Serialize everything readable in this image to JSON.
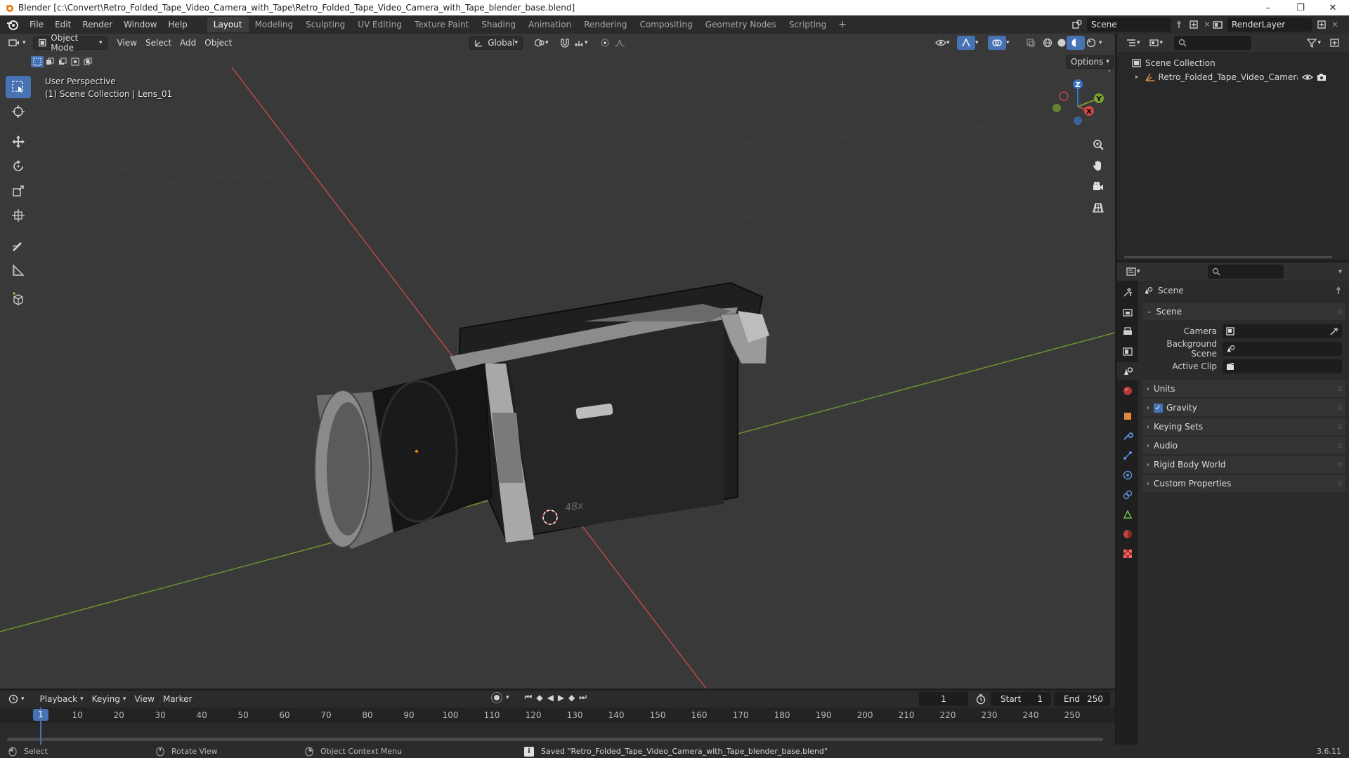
{
  "window": {
    "title": "Blender [c:\\Convert\\Retro_Folded_Tape_Video_Camera_with_Tape\\Retro_Folded_Tape_Video_Camera_with_Tape_blender_base.blend]",
    "minimize": "–",
    "maximize": "❐",
    "close": "✕"
  },
  "menu": {
    "file": "File",
    "edit": "Edit",
    "render": "Render",
    "window": "Window",
    "help": "Help"
  },
  "workspaces": [
    "Layout",
    "Modeling",
    "Sculpting",
    "UV Editing",
    "Texture Paint",
    "Shading",
    "Animation",
    "Rendering",
    "Compositing",
    "Geometry Nodes",
    "Scripting"
  ],
  "active_workspace": "Layout",
  "add_workspace": "+",
  "scene_selector": {
    "value": "Scene"
  },
  "view_layer_selector": {
    "value": "RenderLayer"
  },
  "viewport": {
    "mode": "Object Mode",
    "view_menu": "View",
    "select_menu": "Select",
    "add_menu": "Add",
    "object_menu": "Object",
    "transform_orientation": "Global",
    "options": "Options",
    "overlay_line1": "User Perspective",
    "overlay_line2": "(1) Scene Collection | Lens_01",
    "gizmo": {
      "x": "X",
      "y": "Y",
      "z": "Z"
    },
    "colors": {
      "background": "#393939",
      "x_axis": "#c24a4a",
      "y_axis": "#6f9a2e",
      "active_tool": "#4772b3"
    }
  },
  "outliner": {
    "root": "Scene Collection",
    "item": "Retro_Folded_Tape_Video_Camera_with"
  },
  "properties": {
    "breadcrumb": "Scene",
    "panel_scene": "Scene",
    "camera_label": "Camera",
    "background_scene_label": "Background Scene",
    "active_clip_label": "Active Clip",
    "panels": [
      "Units",
      "Gravity",
      "Keying Sets",
      "Audio",
      "Rigid Body World",
      "Custom Properties"
    ],
    "gravity_checked": true
  },
  "timeline": {
    "playback": "Playback",
    "keying": "Keying",
    "view": "View",
    "marker": "Marker",
    "current_frame": "1",
    "start_label": "Start",
    "start_value": "1",
    "end_label": "End",
    "end_value": "250",
    "ruler": [
      "1",
      "10",
      "20",
      "30",
      "40",
      "50",
      "60",
      "70",
      "80",
      "90",
      "100",
      "110",
      "120",
      "130",
      "140",
      "150",
      "160",
      "170",
      "180",
      "190",
      "200",
      "210",
      "220",
      "230",
      "240",
      "250"
    ]
  },
  "statusbar": {
    "select": "Select",
    "rotate_view": "Rotate View",
    "context_menu": "Object Context Menu",
    "message": "Saved \"Retro_Folded_Tape_Video_Camera_with_Tape_blender_base.blend\"",
    "version": "3.6.11"
  }
}
